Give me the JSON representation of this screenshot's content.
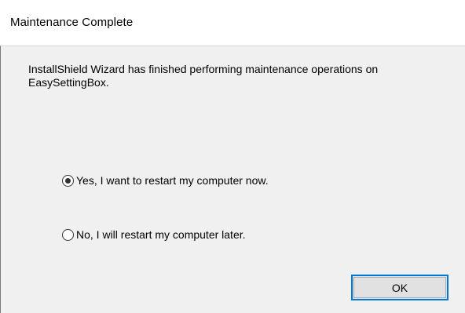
{
  "window": {
    "title": "Maintenance Complete"
  },
  "message": {
    "text": "InstallShield Wizard has finished performing maintenance operations on EasySettingBox."
  },
  "restart_options": [
    {
      "label": "Yes, I want to restart my computer now.",
      "selected": true
    },
    {
      "label": "No, I will restart my computer later.",
      "selected": false
    }
  ],
  "buttons": {
    "ok_label": "OK"
  },
  "colors": {
    "client_background": "#f0f0f0",
    "focus_border": "#0078d7",
    "button_face": "#e1e1e1"
  }
}
